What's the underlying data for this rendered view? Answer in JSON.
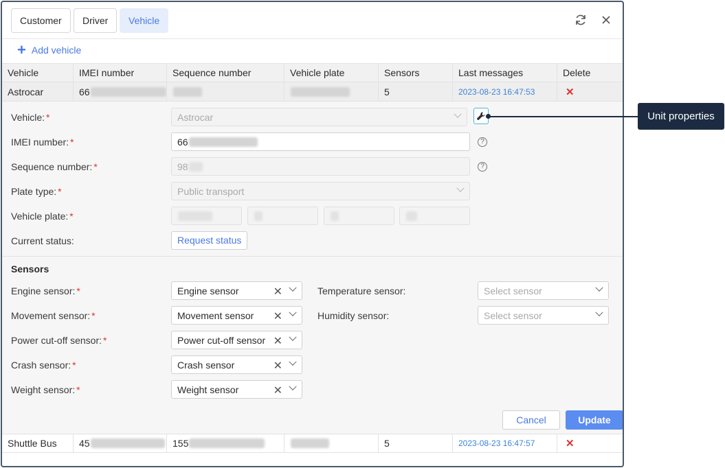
{
  "tabs": [
    {
      "label": "Customer",
      "active": false
    },
    {
      "label": "Driver",
      "active": false
    },
    {
      "label": "Vehicle",
      "active": true
    }
  ],
  "header_icons": [
    "refresh-icon",
    "close-icon"
  ],
  "add_vehicle_label": "Add vehicle",
  "table": {
    "columns": [
      "Vehicle",
      "IMEI number",
      "Sequence number",
      "Vehicle plate",
      "Sensors",
      "Last messages",
      "Delete"
    ],
    "rows": [
      {
        "vehicle": "Astrocar",
        "imei": "66",
        "sequence": "",
        "plate": "",
        "sensors": "5",
        "last_message": "2023-08-23 16:47:53",
        "selected": true
      },
      {
        "vehicle": "Shuttle Bus",
        "imei": "45",
        "sequence": "155",
        "plate": "",
        "sensors": "5",
        "last_message": "2023-08-23 16:47:57",
        "selected": false
      }
    ]
  },
  "form": {
    "vehicle_label": "Vehicle:",
    "vehicle_value": "Astrocar",
    "imei_label": "IMEI number:",
    "imei_value": "66",
    "sequence_label": "Sequence number:",
    "sequence_value": "98",
    "plate_type_label": "Plate type:",
    "plate_type_value": "Public transport",
    "vehicle_plate_label": "Vehicle plate:",
    "current_status_label": "Current status:",
    "request_status_label": "Request status",
    "required_mark": "*"
  },
  "sensors": {
    "title": "Sensors",
    "left": [
      {
        "label": "Engine sensor:",
        "value": "Engine sensor",
        "required": true
      },
      {
        "label": "Movement sensor:",
        "value": "Movement sensor",
        "required": true
      },
      {
        "label": "Power cut-off sensor:",
        "value": "Power cut-off sensor",
        "required": true
      },
      {
        "label": "Crash sensor:",
        "value": "Crash sensor",
        "required": true
      },
      {
        "label": "Weight sensor:",
        "value": "Weight sensor",
        "required": true
      }
    ],
    "right": [
      {
        "label": "Temperature sensor:",
        "placeholder": "Select sensor"
      },
      {
        "label": "Humidity sensor:",
        "placeholder": "Select sensor"
      }
    ]
  },
  "actions": {
    "cancel_label": "Cancel",
    "update_label": "Update"
  },
  "callout": {
    "label": "Unit properties",
    "icon": "wrench-icon"
  },
  "colors": {
    "accent": "#4a79e0",
    "primary_button": "#5b8cf0",
    "delete": "#e03131",
    "callout_bg": "#1c2b41",
    "link": "#3d84d6"
  }
}
